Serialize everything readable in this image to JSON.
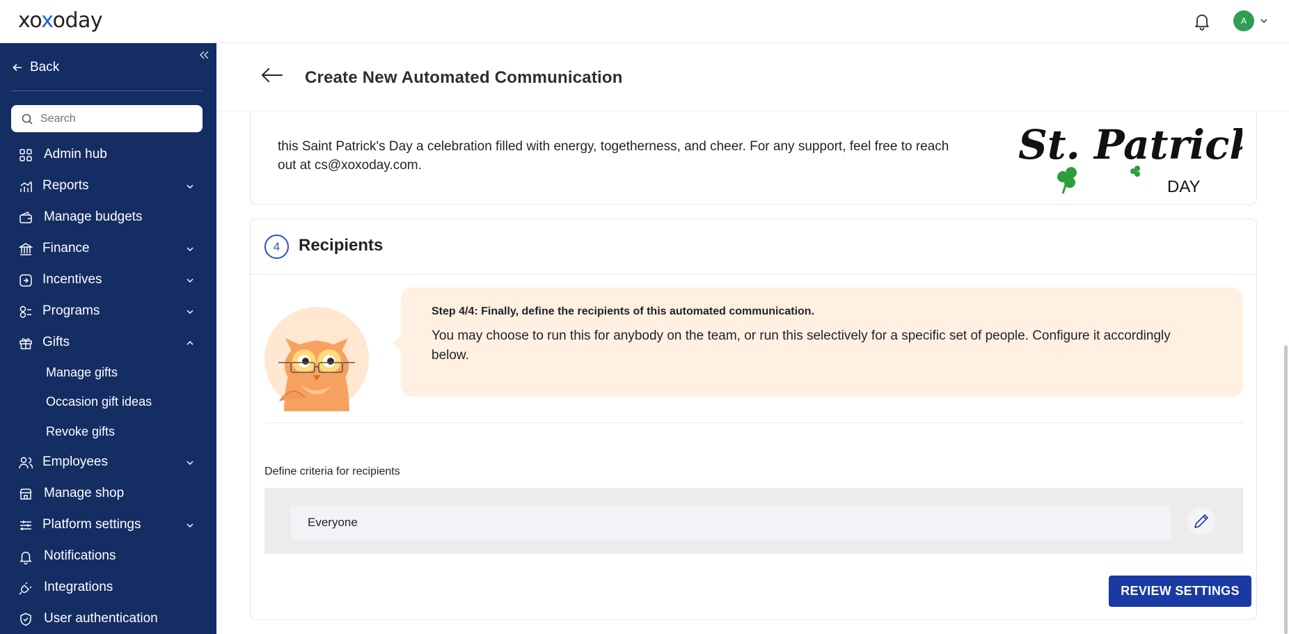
{
  "app": {
    "logo_text": "xoxoday",
    "avatar_initial": "A",
    "accent_color": "#1a3aa3",
    "sidebar_color": "#142d63"
  },
  "sidebar": {
    "back_label": "Back",
    "search_placeholder": "Search",
    "items": [
      {
        "label": "Admin hub",
        "icon": "grid-icon",
        "expandable": false
      },
      {
        "label": "Reports",
        "icon": "chart-icon",
        "expandable": true
      },
      {
        "label": "Manage budgets",
        "icon": "wallet-icon",
        "expandable": false
      },
      {
        "label": "Finance",
        "icon": "bank-icon",
        "expandable": true
      },
      {
        "label": "Incentives",
        "icon": "incentive-icon",
        "expandable": true
      },
      {
        "label": "Programs",
        "icon": "programs-icon",
        "expandable": true
      },
      {
        "label": "Gifts",
        "icon": "gift-icon",
        "expandable": true,
        "expanded": true
      },
      {
        "label": "Employees",
        "icon": "people-icon",
        "expandable": true
      },
      {
        "label": "Manage shop",
        "icon": "shop-icon",
        "expandable": false
      },
      {
        "label": "Platform settings",
        "icon": "sliders-icon",
        "expandable": true
      },
      {
        "label": "Notifications",
        "icon": "bell-icon",
        "expandable": false
      },
      {
        "label": "Integrations",
        "icon": "plug-icon",
        "expandable": false
      },
      {
        "label": "User authentication",
        "icon": "shield-icon",
        "expandable": false
      }
    ],
    "gifts_subitems": [
      "Manage gifts",
      "Occasion gift ideas",
      "Revoke gifts"
    ]
  },
  "page": {
    "title": "Create New Automated Communication"
  },
  "card3": {
    "text_line1": "this Saint Patrick's Day a celebration filled with energy, togetherness, and cheer. For any support, feel free to reach",
    "text_line2": "out at cs@xoxoday.com.",
    "image_text_main": "St. Patrick's",
    "image_text_sub": "DAY"
  },
  "recipients": {
    "step_number": "4",
    "title": "Recipients",
    "bubble_title": "Step 4/4: Finally, define the recipients of this automated communication.",
    "bubble_text": "You may choose to run this for anybody on the team, or run this selectively for a specific set of people. Configure it accordingly below.",
    "criteria_label": "Define criteria for recipients",
    "criteria_value": "Everyone",
    "review_button": "REVIEW SETTINGS"
  }
}
